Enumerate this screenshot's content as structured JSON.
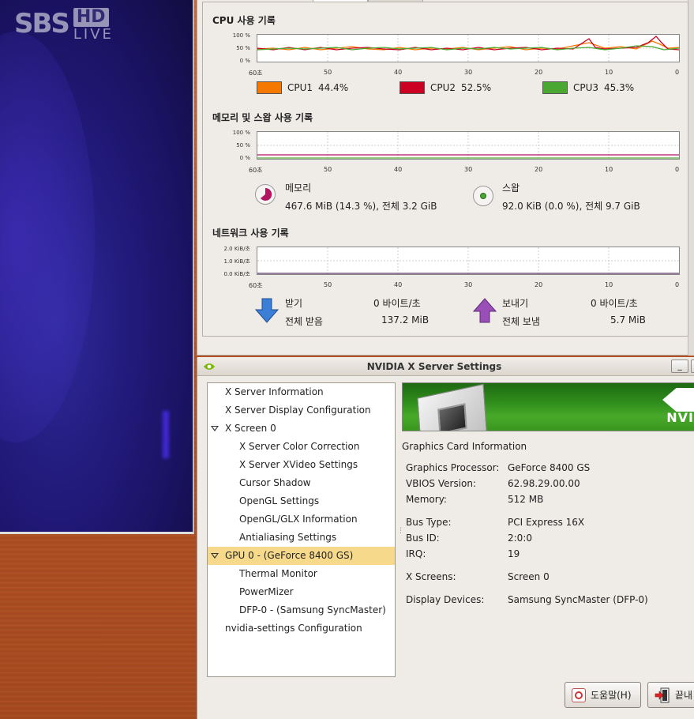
{
  "tv": {
    "brand": "SBS",
    "badge": "HD",
    "live": "LIVE"
  },
  "sysmon": {
    "cpu": {
      "title": "CPU 사용 기록",
      "y_labels": [
        "100 %",
        "50 %",
        "0 %"
      ],
      "x_labels": [
        "60초",
        "50",
        "40",
        "30",
        "20",
        "10",
        "0"
      ],
      "legend": [
        {
          "name": "CPU1",
          "value": "44.4%",
          "color": "#f57900"
        },
        {
          "name": "CPU2",
          "value": "52.5%",
          "color": "#cc0022"
        },
        {
          "name": "CPU3",
          "value": "45.3%",
          "color": "#4aa832"
        }
      ]
    },
    "memory": {
      "title": "메모리 및 스왑 사용 기록",
      "y_labels": [
        "100 %",
        "50 %",
        "0 %"
      ],
      "x_labels": [
        "60초",
        "50",
        "40",
        "30",
        "20",
        "10",
        "0"
      ],
      "mem_label": "메모리",
      "mem_value": "467.6 MiB (14.3 %), 전체 3.2 GiB",
      "mem_color": "#b01560",
      "swap_label": "스왑",
      "swap_value": "92.0 KiB (0.0 %), 전체 9.7 GiB",
      "swap_color": "#4aa832"
    },
    "network": {
      "title": "네트워크 사용 기록",
      "y_labels": [
        "2.0 KiB/초",
        "1.0 KiB/초",
        "0.0 KiB/초"
      ],
      "x_labels": [
        "60초",
        "50",
        "40",
        "30",
        "20",
        "10",
        "0"
      ],
      "recv_label": "받기",
      "recv_rate": "0 바이트/초",
      "recv_total_label": "전체 받음",
      "recv_total": "137.2 MiB",
      "send_label": "보내기",
      "send_rate": "0 바이트/초",
      "send_total_label": "전체 보냄",
      "send_total": "5.7 MiB"
    }
  },
  "nvidia": {
    "title": "NVIDIA X Server Settings",
    "minimize": "_",
    "tree": [
      {
        "label": "X Server Information",
        "indent": 0
      },
      {
        "label": "X Server Display Configuration",
        "indent": 0
      },
      {
        "label": "X Screen 0",
        "indent": 0,
        "expanded": true
      },
      {
        "label": "X Server Color Correction",
        "indent": 1
      },
      {
        "label": "X Server XVideo Settings",
        "indent": 1
      },
      {
        "label": "Cursor Shadow",
        "indent": 1
      },
      {
        "label": "OpenGL Settings",
        "indent": 1
      },
      {
        "label": "OpenGL/GLX Information",
        "indent": 1
      },
      {
        "label": "Antialiasing Settings",
        "indent": 1
      },
      {
        "label": "GPU 0 - (GeForce 8400 GS)",
        "indent": 0,
        "expanded": true,
        "selected": true
      },
      {
        "label": "Thermal Monitor",
        "indent": 1
      },
      {
        "label": "PowerMizer",
        "indent": 1
      },
      {
        "label": "DFP-0 - (Samsung SyncMaster)",
        "indent": 1
      },
      {
        "label": "nvidia-settings Configuration",
        "indent": 0
      }
    ],
    "banner_word": "NVI",
    "info_header": "Graphics Card Information",
    "info": [
      {
        "label": "Graphics Processor:",
        "value": "GeForce 8400 GS"
      },
      {
        "label": "VBIOS Version:",
        "value": "62.98.29.00.00"
      },
      {
        "label": "Memory:",
        "value": "512 MB"
      },
      {
        "label": "Bus Type:",
        "value": "PCI Express 16X"
      },
      {
        "label": "Bus ID:",
        "value": "2:0:0"
      },
      {
        "label": "IRQ:",
        "value": "19"
      },
      {
        "label": "X Screens:",
        "value": "Screen 0"
      },
      {
        "label": "Display Devices:",
        "value": "Samsung SyncMaster (DFP-0)"
      }
    ],
    "help_button": "도움말(H)",
    "quit_button": "끝내"
  }
}
